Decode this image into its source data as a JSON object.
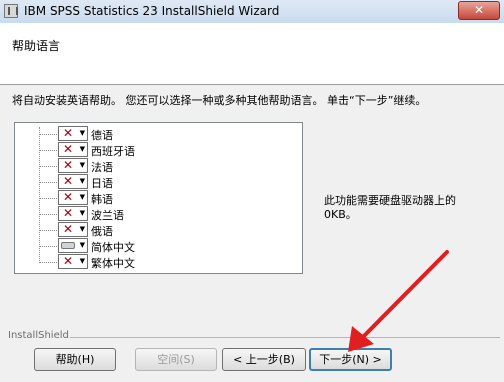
{
  "window": {
    "title": "IBM SPSS Statistics 23 InstallShield Wizard",
    "close_glyph": "✕"
  },
  "header": {
    "title": "帮助语言"
  },
  "instruction": "将自动安装英语帮助。 您还可以选择一种或多种其他帮助语言。 单击“下一步”继续。",
  "languages": [
    {
      "label": "德语",
      "state": "x"
    },
    {
      "label": "西班牙语",
      "state": "x"
    },
    {
      "label": "法语",
      "state": "x"
    },
    {
      "label": "日语",
      "state": "x"
    },
    {
      "label": "韩语",
      "state": "x"
    },
    {
      "label": "波兰语",
      "state": "x"
    },
    {
      "label": "俄语",
      "state": "x"
    },
    {
      "label": "简体中文",
      "state": "drive"
    },
    {
      "label": "繁体中文",
      "state": "x"
    }
  ],
  "space_info": {
    "line1": "此功能需要硬盘驱动器上的",
    "line2": "0KB。"
  },
  "footer": {
    "brand": "InstallShield",
    "help_label": "帮助(H)",
    "space_label": "空间(S)",
    "back_label": "< 上一步(B)",
    "next_label": "下一步(N) >"
  },
  "colors": {
    "annotation_arrow": "#e02020"
  }
}
